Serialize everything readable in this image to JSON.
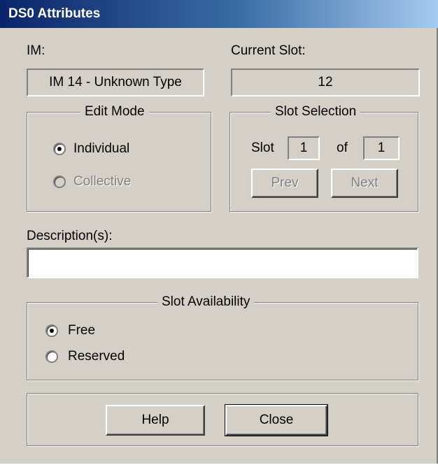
{
  "window": {
    "title": "DS0 Attributes"
  },
  "im": {
    "label": "IM:",
    "value": "IM 14 - Unknown Type"
  },
  "current_slot": {
    "label": "Current Slot:",
    "value": "12"
  },
  "edit_mode": {
    "legend": "Edit Mode",
    "options": [
      {
        "label": "Individual",
        "selected": true,
        "enabled": true
      },
      {
        "label": "Collective",
        "selected": false,
        "enabled": false
      }
    ]
  },
  "slot_selection": {
    "legend": "Slot Selection",
    "slot_label": "Slot",
    "slot_value": "1",
    "of_label": "of",
    "total_value": "1",
    "prev_label": "Prev",
    "next_label": "Next"
  },
  "description": {
    "label": "Description(s):",
    "value": ""
  },
  "slot_availability": {
    "legend": "Slot Availability",
    "options": [
      {
        "label": "Free",
        "selected": true
      },
      {
        "label": "Reserved",
        "selected": false
      }
    ]
  },
  "buttons": {
    "help_label": "Help",
    "close_label": "Close"
  }
}
